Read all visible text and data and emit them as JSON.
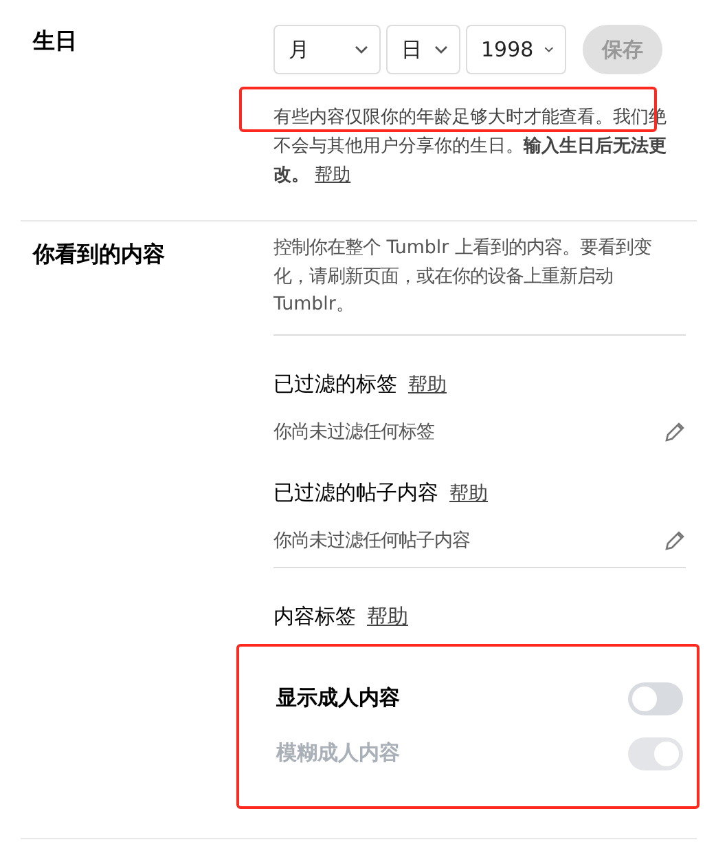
{
  "birthday": {
    "label": "生日",
    "selects": [
      {
        "value": "月"
      },
      {
        "value": "日"
      },
      {
        "value": "1998"
      }
    ],
    "save_button": {
      "label": "保存",
      "disabled": true
    },
    "note": "有些内容仅限你的年龄足够大时才能查看。我们绝不会与其他用户分享你的生日。**输入生日后无法更改。**",
    "note_link": "帮助",
    "note_highlighted": true
  },
  "content": {
    "label": "你看到的内容",
    "description": "控制你在整个 Tumblr 上看到的内容。要看到变化，请刷新页面，或在你的设备上重新启动 Tumblr。",
    "filters": [
      {
        "title": "已过滤的标签",
        "help": "帮助",
        "value": "你尚未过滤任何标签"
      },
      {
        "title": "已过滤的帖子内容",
        "help": "帮助",
        "value": "你尚未过滤任何帖子内容"
      }
    ],
    "content_labels": {
      "title": "内容标签",
      "help": "帮助",
      "highlighted": true,
      "toggles": [
        {
          "label": "显示成人内容",
          "on": false,
          "disabled": false
        },
        {
          "label": "模糊成人内容",
          "on": true,
          "disabled": true
        }
      ]
    }
  }
}
